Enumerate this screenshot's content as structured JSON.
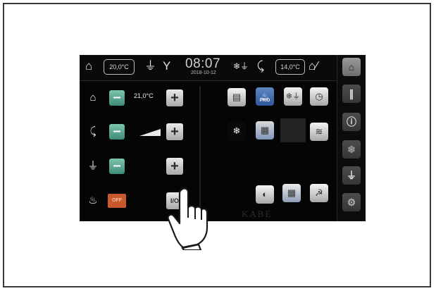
{
  "status_bar": {
    "indoor_temp": "20,0°C",
    "outdoor_temp": "14,0°C",
    "time": "08:07",
    "date": "2018-10-12",
    "icons": [
      "house-icon",
      "plug-icon",
      "antenna-icon",
      "snowflake-plug-icon",
      "shower-icon",
      "house-thermometer-icon"
    ]
  },
  "controls": {
    "heating_setpoint": "21,0°C",
    "rows": [
      {
        "name": "heating",
        "icon": "house-icon"
      },
      {
        "name": "hot-water",
        "icon": "shower-icon"
      },
      {
        "name": "electric",
        "icon": "plug-icon"
      },
      {
        "name": "gas-flame",
        "icon": "flame-icon"
      }
    ],
    "off_label": "OFF",
    "io_label": "I/O"
  },
  "tiles": {
    "prio_label": "PRIO",
    "items": [
      "radiator-icon",
      "flame-prio-icon",
      "snowflake-plug-icon",
      "timer-thermometer-icon",
      "gas-bottle-snowflake-icon",
      "aux-heater-icon",
      "floor-heating-icon",
      "windscreen-heater-icon",
      "panel-heater-icon",
      "seat-heater-icon"
    ]
  },
  "brand": "KABE",
  "sidebar": [
    "home-icon",
    "thermometer-icon",
    "info-icon",
    "snowflake-icon",
    "plug-icon",
    "gear-icon"
  ],
  "colors": {
    "minus_accent": "#4fa48c",
    "off_button": "#c7592c",
    "prio_tile": "#2e5699"
  }
}
